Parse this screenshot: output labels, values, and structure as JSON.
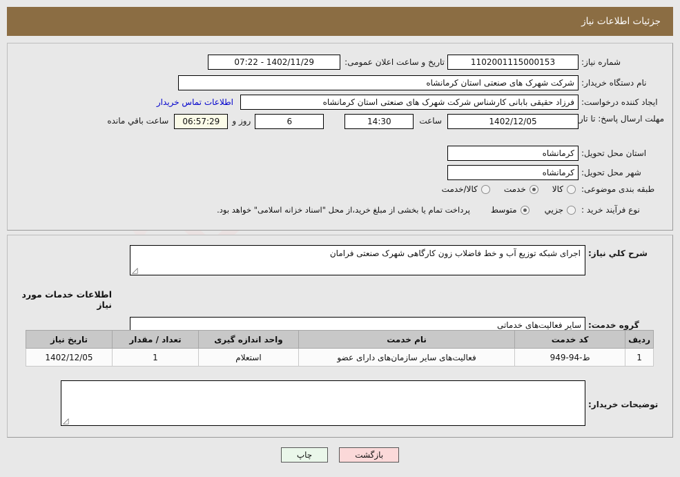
{
  "header": {
    "title": "جزئیات اطلاعات نیاز",
    "bar_color": "#8b6d43"
  },
  "watermark": {
    "text": "AriaTender.net"
  },
  "top_panel": {
    "need_number_label": "شماره نیاز:",
    "need_number_value": "1102001115000153",
    "public_announce_label": "تاریخ و ساعت اعلان عمومی:",
    "public_announce_value": "1402/11/29 - 07:22",
    "buyer_org_label": "نام دستگاه خریدار:",
    "buyer_org_value": "شرکت شهرک های صنعتی استان کرمانشاه",
    "requester_label": "ایجاد کننده درخواست:",
    "requester_value": "فرزاد حقیقی بابانی کارشناس شرکت شهرک های صنعتی استان کرمانشاه",
    "contact_link": "اطلاعات تماس خریدار",
    "deadline_label": "مهلت ارسال پاسخ: تا تاریخ:",
    "deadline_date": "1402/12/05",
    "hour_label": "ساعت",
    "deadline_time": "14:30",
    "days_value": "6",
    "days_label": "روز و",
    "countdown_value": "06:57:29",
    "countdown_label": "ساعت باقي مانده",
    "province_label": "استان محل تحویل:",
    "province_value": "کرمانشاه",
    "city_label": "شهر محل تحویل:",
    "city_value": "کرمانشاه",
    "category_label": "طبقه بندی موضوعی:",
    "category_options": [
      {
        "label": "کالا",
        "checked": false
      },
      {
        "label": "خدمت",
        "checked": true
      },
      {
        "label": "کالا/خدمت",
        "checked": false
      }
    ],
    "process_label": "نوع فرآیند خرید :",
    "process_options": [
      {
        "label": "جزيي",
        "checked": false
      },
      {
        "label": "متوسط",
        "checked": true
      }
    ],
    "process_note": "پرداخت تمام یا بخشی از مبلغ خرید،از محل \"اسناد خزانه اسلامی\" خواهد بود."
  },
  "bottom_panel": {
    "general_desc_label": "شرح كلي نياز:",
    "general_desc_value": "اجرای شبکه توزیع آب و خط فاضلاب زون کارگاهی شهرک صنعتی فرامان",
    "services_heading": "اطلاعات خدمات مورد نیاز",
    "service_group_label": "گروه خدمت:",
    "service_group_value": "سایر فعالیت‌های خدماتی",
    "buyer_notes_label": "توضیحات خریدار:",
    "buyer_notes_value": ""
  },
  "items_table": {
    "columns": [
      "ردیف",
      "کد خدمت",
      "نام خدمت",
      "واحد اندازه گیری",
      "تعداد / مقدار",
      "تاریخ نیاز"
    ],
    "rows": [
      {
        "index": "1",
        "code": "ط-94-949",
        "name": "فعالیت‌های سایر سازمان‌های دارای عضو",
        "unit": "استعلام",
        "qty": "1",
        "date": "1402/12/05"
      }
    ]
  },
  "buttons": {
    "print": "چاپ",
    "back": "بازگشت"
  }
}
